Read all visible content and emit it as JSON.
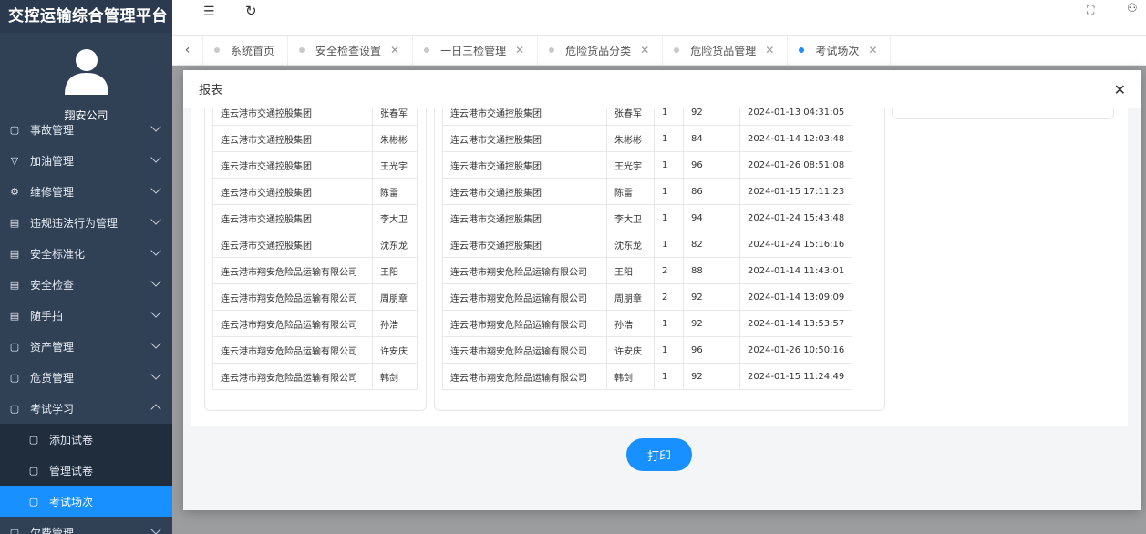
{
  "brand": "交控运输综合管理平台",
  "company": "翔安公司",
  "menu": [
    {
      "label": "事故管理",
      "icon": "box-icon"
    },
    {
      "label": "加油管理",
      "icon": "filter-icon"
    },
    {
      "label": "维修管理",
      "icon": "gear-icon"
    },
    {
      "label": "违规违法行为管理",
      "icon": "message-icon"
    },
    {
      "label": "安全标准化",
      "icon": "message-icon"
    },
    {
      "label": "安全检查",
      "icon": "message-icon"
    },
    {
      "label": "随手拍",
      "icon": "message-icon"
    },
    {
      "label": "资产管理",
      "icon": "box-icon"
    },
    {
      "label": "危货管理",
      "icon": "box-icon"
    },
    {
      "label": "考试学习",
      "icon": "box-icon"
    }
  ],
  "submenu": [
    {
      "label": "添加试卷"
    },
    {
      "label": "管理试卷"
    },
    {
      "label": "考试场次"
    }
  ],
  "menu_after": {
    "label": "欠费管理"
  },
  "tabs": [
    {
      "label": "系统首页"
    },
    {
      "label": "安全检查设置"
    },
    {
      "label": "一日三检管理"
    },
    {
      "label": "危险货品分类"
    },
    {
      "label": "危险货品管理"
    },
    {
      "label": "考试场次"
    }
  ],
  "modal": {
    "title": "报表",
    "close": "✕",
    "print_label": "打印"
  },
  "left_table": [
    [
      "连云港市交通控股集团",
      "张春军"
    ],
    [
      "连云港市交通控股集团",
      "朱彬彬"
    ],
    [
      "连云港市交通控股集团",
      "王光宇"
    ],
    [
      "连云港市交通控股集团",
      "陈雷"
    ],
    [
      "连云港市交通控股集团",
      "李大卫"
    ],
    [
      "连云港市交通控股集团",
      "沈东龙"
    ],
    [
      "连云港市翔安危险品运输有限公司",
      "王阳"
    ],
    [
      "连云港市翔安危险品运输有限公司",
      "周朋章"
    ],
    [
      "连云港市翔安危险品运输有限公司",
      "孙浩"
    ],
    [
      "连云港市翔安危险品运输有限公司",
      "许安庆"
    ],
    [
      "连云港市翔安危险品运输有限公司",
      "韩剑"
    ]
  ],
  "right_table": [
    [
      "连云港市交通控股集团",
      "张春军",
      "1",
      "92",
      "2024-01-13 04:31:05"
    ],
    [
      "连云港市交通控股集团",
      "朱彬彬",
      "1",
      "84",
      "2024-01-14 12:03:48"
    ],
    [
      "连云港市交通控股集团",
      "王光宇",
      "1",
      "96",
      "2024-01-26 08:51:08"
    ],
    [
      "连云港市交通控股集团",
      "陈雷",
      "1",
      "86",
      "2024-01-15 17:11:23"
    ],
    [
      "连云港市交通控股集团",
      "李大卫",
      "1",
      "94",
      "2024-01-24 15:43:48"
    ],
    [
      "连云港市交通控股集团",
      "沈东龙",
      "1",
      "82",
      "2024-01-24 15:16:16"
    ],
    [
      "连云港市翔安危险品运输有限公司",
      "王阳",
      "2",
      "88",
      "2024-01-14 11:43:01"
    ],
    [
      "连云港市翔安危险品运输有限公司",
      "周朋章",
      "2",
      "92",
      "2024-01-14 13:09:09"
    ],
    [
      "连云港市翔安危险品运输有限公司",
      "孙浩",
      "1",
      "92",
      "2024-01-14 13:53:57"
    ],
    [
      "连云港市翔安危险品运输有限公司",
      "许安庆",
      "1",
      "96",
      "2024-01-26 10:50:16"
    ],
    [
      "连云港市翔安危险品运输有限公司",
      "韩剑",
      "1",
      "92",
      "2024-01-15 11:24:49"
    ]
  ]
}
